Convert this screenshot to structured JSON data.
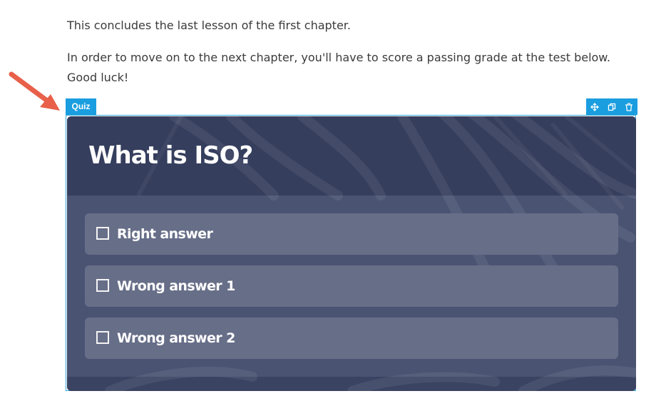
{
  "intro": {
    "line1": "This concludes the last lesson of the first chapter.",
    "line2": "In order to move on to the next chapter, you'll have to score a passing grade at the test below. Good luck!"
  },
  "block": {
    "tab_label": "Quiz",
    "tools": [
      {
        "icon": "move-icon"
      },
      {
        "icon": "copy-icon"
      },
      {
        "icon": "trash-icon"
      }
    ]
  },
  "quiz": {
    "question": "What is ISO?",
    "answers": [
      {
        "label": "Right answer",
        "checked": false
      },
      {
        "label": "Wrong answer 1",
        "checked": false
      },
      {
        "label": "Wrong answer 2",
        "checked": false
      }
    ]
  },
  "colors": {
    "accent": "#1a9ee0",
    "annotation_arrow": "#e8604a",
    "card_header": "#353e5d",
    "card_body": "#4a5372",
    "answer_bg": "#676e88"
  }
}
